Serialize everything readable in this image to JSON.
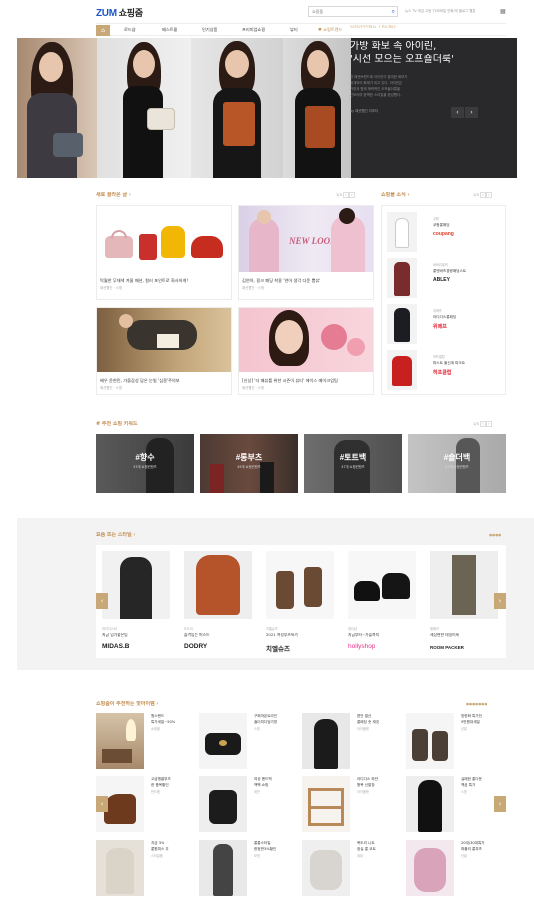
{
  "header": {
    "logo": "ZUM",
    "logo_sub": "쇼핑줌",
    "search_placeholder": "쇼핑줌",
    "search_icon": "search-icon",
    "top_links": "뉴스  TV  게임  고등  TV모바일  만화/게  블로그  웹툰",
    "menu_icon": "grid-icon"
  },
  "nav": {
    "home_icon": "home-icon",
    "items": [
      "로드샵",
      "베스트몰",
      "인기상품",
      "프리미엄쇼핑",
      "뷰티",
      "♥ 쇼핑트렌드"
    ],
    "accent": "#c8a876"
  },
  "hero": {
    "tag": "SHOPPING TREND",
    "title_line1": "가방 화보 속 아이린,",
    "title_line2": "'시선 모으는 오프숄더룩'",
    "desc_lines": [
      "한 패션브랜드에 아이린이 참여한 화보가",
      "공개되어 화제가 되고 있다. 아이린은",
      "가방과 함께 매력적인 오프숄더룩을",
      "선보이며 완벽한 스타일을 완성했다."
    ],
    "source": "by 패션웹진 리포터",
    "prev": "‹",
    "next": "›",
    "dots": "● ● ● ●"
  },
  "new_posts": {
    "title": "새로 올라온 글 ›",
    "pager": "1/3",
    "prev": "‹",
    "next": "›",
    "cards": [
      {
        "title": "탁월한 무채색 겨울 패션, 컬러 포인트로 화사하게!",
        "meta": "패션웹진 · 스윙"
      },
      {
        "title": "김연아, 핑크 패딩 착용 '연아 생각 다운 뽐뷰'",
        "meta": "패션웹진 · 스윙"
      },
      {
        "title": "배우 윤현민, 가을감성 담은 눈빛 '심쿵'주의보",
        "meta": "패션웹진 · 스윙"
      },
      {
        "title": "[신상] '더 패뷰를 위한 시즌이 뷰티' 에이스 메이크업팀",
        "meta": "패션웹진 · 스윙"
      }
    ],
    "promo_text": "NEW LOOK"
  },
  "mall_news": {
    "title": "쇼핑몰 소식 ›",
    "pager": "1/3",
    "prev": "‹",
    "next": "›",
    "items": [
      {
        "cat": "쿠팡",
        "name": "쿠팡롱패딩",
        "logo": "coupang",
        "logo_color": "#e0412b"
      },
      {
        "cat": "버버리셀러",
        "name": "롱엔버즈경량패딩스트",
        "logo": "ABLEY",
        "logo_color": "#222222"
      },
      {
        "cat": "위메프",
        "name": "아디다스롱패딩",
        "logo": "위메프",
        "logo_color": "#e01f2d"
      },
      {
        "cat": "하프클럽",
        "name": "파스트 울신계 파크트",
        "logo": "하프클럽",
        "logo_color": "#e01f2d"
      }
    ]
  },
  "keywords": {
    "title": "# 추천 쇼핑 키워드",
    "pager": "1/3",
    "prev": "‹",
    "next": "›",
    "items": [
      {
        "label": "#향수",
        "sub": "53개 쇼핑컨텐츠"
      },
      {
        "label": "#롱부츠",
        "sub": "49개 쇼핑컨텐츠"
      },
      {
        "label": "#토트백",
        "sub": "47개 쇼핑컨텐츠"
      },
      {
        "label": "#숄더백",
        "sub": "52개 쇼핑컨텐츠"
      }
    ]
  },
  "styles": {
    "title": "요즘 뜨는 스타일 ›",
    "dots": "●●●●",
    "prev": "‹",
    "next": "›",
    "items": [
      {
        "cat": "마이다스비",
        "desc": "지금 입기좋은팀",
        "logo": "MIDAS.B",
        "logo_color": "#111111"
      },
      {
        "cat": "도드리",
        "desc": "즐겨입는 머스트",
        "logo": "DODRY",
        "logo_color": "#111111"
      },
      {
        "cat": "지엘슈즈",
        "desc": "2021 여성부츠특가",
        "logo": "치엘슈즈",
        "logo_color": "#111111"
      },
      {
        "cat": "할리샵",
        "desc": "지금부터~가을까지",
        "logo": "hollyshop",
        "logo_color": "#e8308a"
      },
      {
        "cat": "룸패커",
        "desc": "세상편한 데일리룩",
        "logo": "ROOM PACKER",
        "logo_color": "#111111"
      }
    ]
  },
  "recommended": {
    "title": "쇼핑줌이 추천하는 핫아이템 ›",
    "dots": "●●●●●●●",
    "prev": "‹",
    "next": "›",
    "items": [
      {
        "t1": "원스탠드",
        "t2": "특가세일~50%",
        "s": "쇼핑몰"
      },
      {
        "t1": "구찌마몬트라인",
        "t2": "숄더미디엄가방",
        "s": "스윙"
      },
      {
        "t1": "편안 발산",
        "t2": "롱패딩 숏 재킷",
        "s": "아이몰켓"
      },
      {
        "t1": "방한화 특가전",
        "t2": "5만원대세일",
        "s": "신발"
      },
      {
        "t1": "고급앵클부츠",
        "t2": "한 품목할인",
        "s": "반드룸"
      },
      {
        "t1": "여성 핸드백",
        "t2": "백팩 쇼핑",
        "s": "데빈"
      },
      {
        "t1": "아디다스 하얀",
        "t2": "원목 신발장",
        "s": "아이몰켓"
      },
      {
        "t1": "실패한 롱다운",
        "t2": "백곰 특가",
        "s": "스윙"
      },
      {
        "t1": "지금 3%",
        "t2": "롱원피스 우",
        "s": "스타일몰"
      },
      {
        "t1": "롱롱스타일",
        "t2": "한정판3%할인",
        "s": "보겟"
      },
      {
        "t1": "목도리 니트",
        "t2": "잠실 롱 코트",
        "s": "세대"
      },
      {
        "t1": "20대/30대특가",
        "t2": "퍼플리 롱부츠",
        "s": "신발"
      }
    ]
  }
}
